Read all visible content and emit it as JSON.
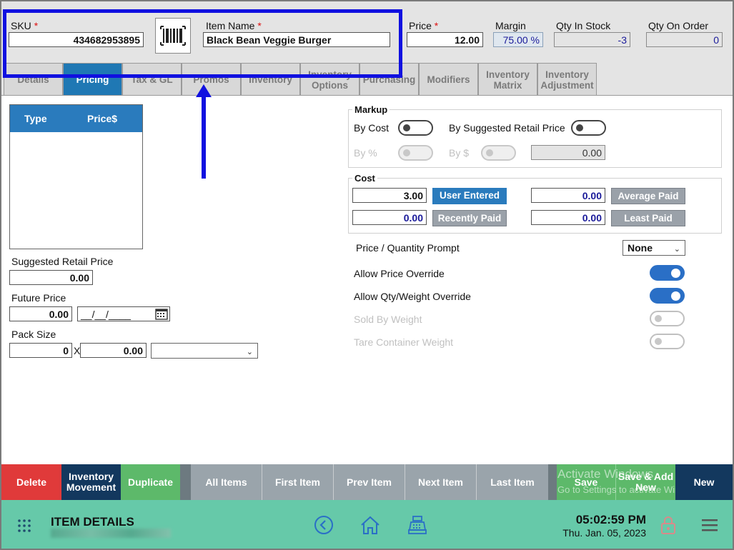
{
  "header": {
    "sku_label": "SKU",
    "sku_value": "434682953895",
    "item_name_label": "Item Name",
    "item_name_value": "Black Bean Veggie Burger",
    "price_label": "Price",
    "price_value": "12.00",
    "margin_label": "Margin",
    "margin_value": "75.00 %",
    "qty_in_stock_label": "Qty In Stock",
    "qty_in_stock_value": "-3",
    "qty_on_order_label": "Qty On Order",
    "qty_on_order_value": "0",
    "required_mark": "*"
  },
  "tabs": [
    {
      "label": "Details"
    },
    {
      "label": "Pricing",
      "active": true
    },
    {
      "label": "Tax & GL"
    },
    {
      "label": "Promos"
    },
    {
      "label": "Inventory"
    },
    {
      "label": "Inventory Options"
    },
    {
      "label": "Purchasing"
    },
    {
      "label": "Modifiers"
    },
    {
      "label": "Inventory Matrix"
    },
    {
      "label": "Inventory Adjustment"
    }
  ],
  "price_grid": {
    "col_type": "Type",
    "col_price": "Price$"
  },
  "left_form": {
    "suggested_retail_label": "Suggested Retail Price",
    "suggested_retail_value": "0.00",
    "future_price_label": "Future Price",
    "future_price_value": "0.00",
    "future_date_value": "__/__/____",
    "pack_size_label": "Pack Size",
    "pack_size_qty": "0",
    "pack_size_x": "X",
    "pack_size_price": "0.00",
    "pack_size_unit": ""
  },
  "markup": {
    "title": "Markup",
    "by_cost_label": "By Cost",
    "by_srp_label": "By Suggested Retail Price",
    "by_percent_label": "By %",
    "by_dollar_label": "By $",
    "markup_value": "0.00"
  },
  "cost": {
    "title": "Cost",
    "user_entered_value": "3.00",
    "user_entered_label": "User Entered",
    "recently_paid_value": "0.00",
    "recently_paid_label": "Recently Paid",
    "average_paid_value": "0.00",
    "average_paid_label": "Average Paid",
    "least_paid_value": "0.00",
    "least_paid_label": "Least Paid"
  },
  "options": {
    "price_qty_prompt_label": "Price / Quantity Prompt",
    "price_qty_prompt_value": "None",
    "allow_price_override_label": "Allow Price Override",
    "allow_price_override": true,
    "allow_qty_weight_override_label": "Allow Qty/Weight Override",
    "allow_qty_weight_override": true,
    "sold_by_weight_label": "Sold By Weight",
    "sold_by_weight": false,
    "tare_container_weight_label": "Tare Container Weight",
    "tare_container_weight": false
  },
  "bottom_buttons": {
    "delete": "Delete",
    "inventory_movement": "Inventory Movement",
    "duplicate": "Duplicate",
    "all_items": "All Items",
    "first_item": "First Item",
    "prev_item": "Prev Item",
    "next_item": "Next Item",
    "last_item": "Last Item",
    "save": "Save",
    "save_add_new": "Save & Add New",
    "new": "New"
  },
  "watermark": {
    "line1": "Activate Windows",
    "line2": "Go to Settings to activate Windows."
  },
  "footer": {
    "title": "ITEM DETAILS",
    "time": "05:02:59 PM",
    "date": "Thu. Jan. 05, 2023"
  },
  "colors": {
    "accent_blue": "#2a7bbd",
    "delete_red": "#e03a3a",
    "nav_navy": "#13385e",
    "green": "#5db96a",
    "footer_teal": "#66c9a9",
    "annotation_blue": "#1010e0"
  },
  "icons": {
    "barcode": "barcode-icon",
    "calendar": "calendar-icon",
    "grid": "app-grid-icon",
    "back": "back-circle-icon",
    "home": "home-icon",
    "register": "cash-register-icon",
    "lock": "lock-icon",
    "menu": "hamburger-menu-icon"
  }
}
